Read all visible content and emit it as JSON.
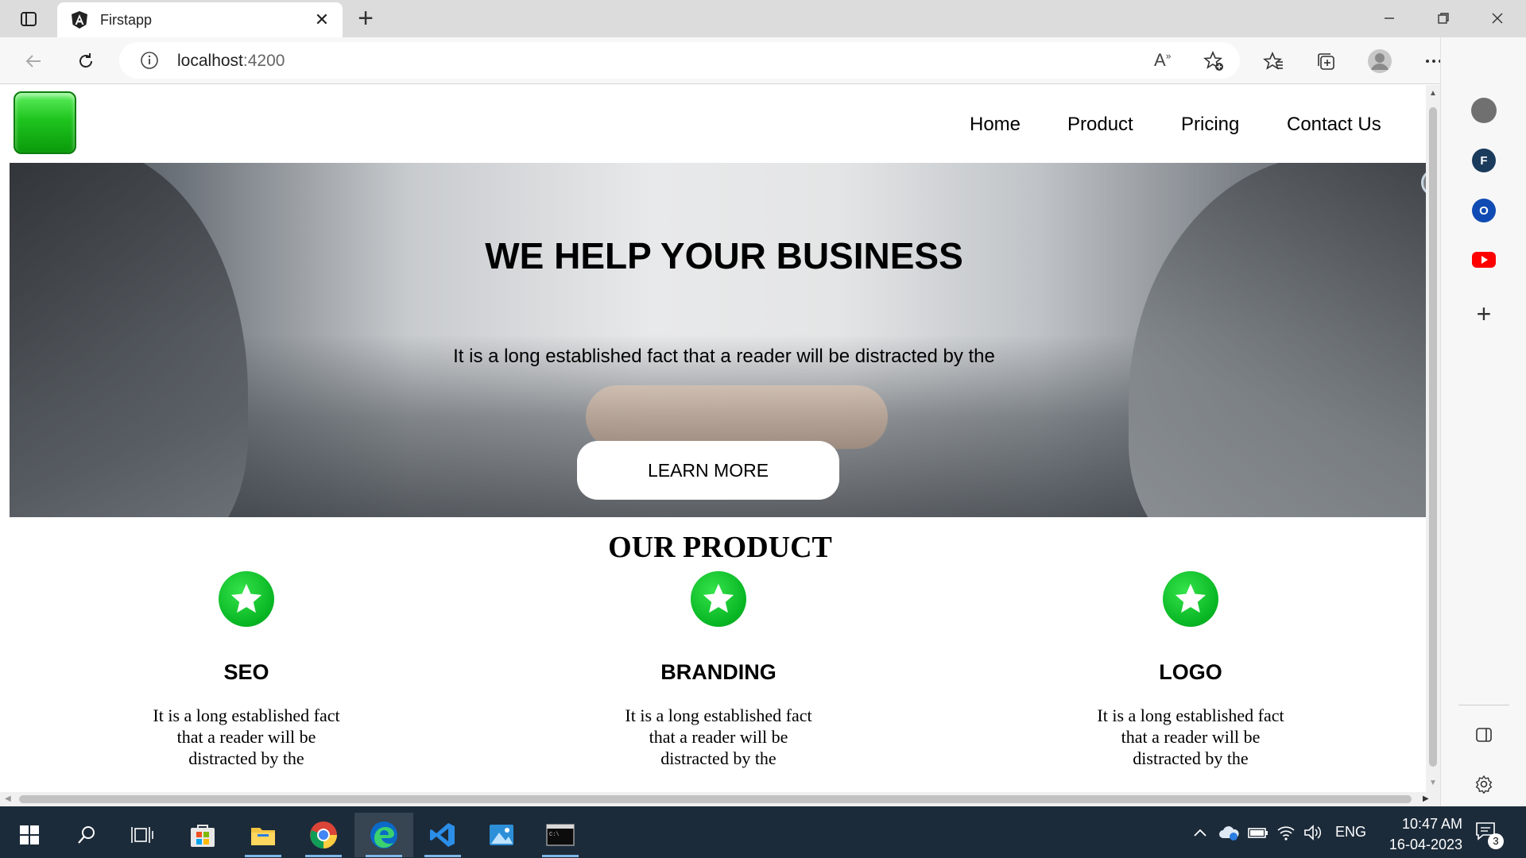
{
  "browser": {
    "tab_title": "Firstapp",
    "tab_close": "✕",
    "new_tab": "+",
    "url_host": "localhost",
    "url_port": ":4200"
  },
  "page": {
    "nav": [
      "Home",
      "Product",
      "Pricing",
      "Contact Us"
    ],
    "hero": {
      "title": "WE HELP YOUR BUSINESS",
      "text": "It is a long established fact that a reader will be distracted by the",
      "button": "LEARN MORE"
    },
    "products_title": "OUR PRODUCT",
    "products": [
      {
        "title": "SEO",
        "text": "It is a long established fact that a reader will be distracted by the"
      },
      {
        "title": "BRANDING",
        "text": "It is a long established fact that a reader will be distracted by the"
      },
      {
        "title": "LOGO",
        "text": "It is a long established fact that a reader will be distracted by the"
      }
    ]
  },
  "sidebar": {
    "items": [
      {
        "icon": "profile-circle-icon",
        "label": ""
      },
      {
        "icon": "f-circle-icon",
        "label": "F"
      },
      {
        "icon": "o-circle-icon",
        "label": "O"
      },
      {
        "icon": "youtube-icon",
        "label": ""
      }
    ],
    "add": "+"
  },
  "taskbar": {
    "lang": "ENG",
    "time": "10:47 AM",
    "date": "16-04-2023",
    "notifications": "3"
  },
  "colors": {
    "accent_green": "#07b523",
    "taskbar": "#1c2b3a",
    "youtube_red": "#ff0000",
    "outlook_blue": "#0f4bb3",
    "edge_blue": "#0b6ac7"
  }
}
